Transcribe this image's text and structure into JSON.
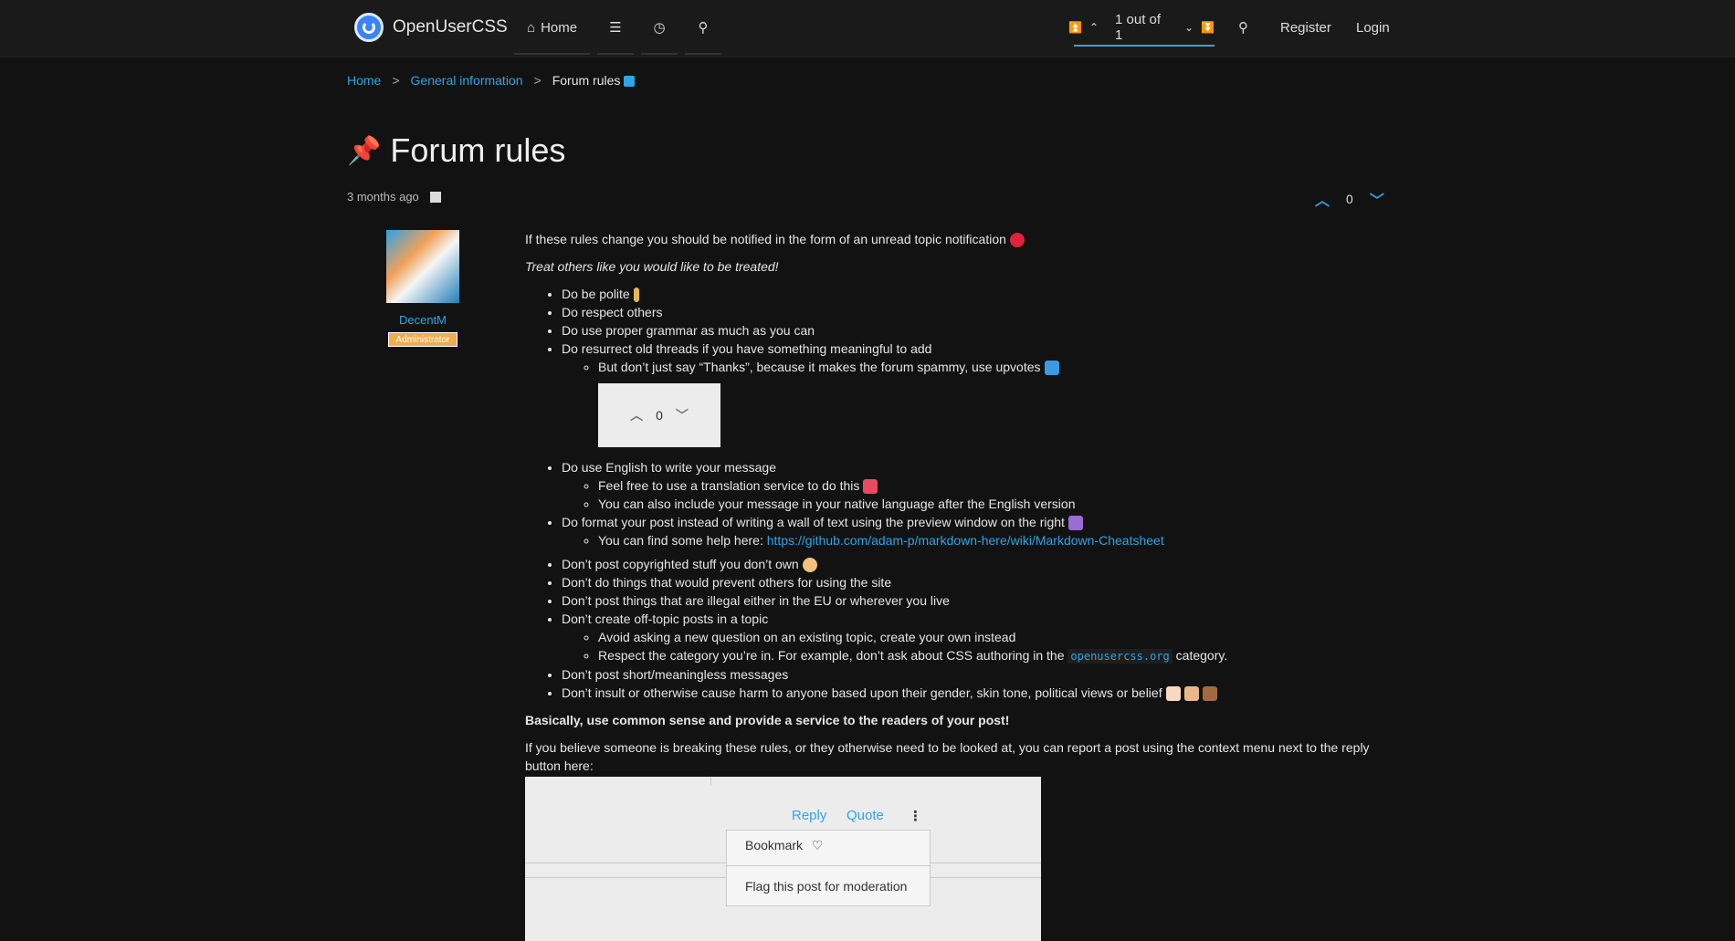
{
  "nav": {
    "brand": "OpenUserCSS",
    "home": "Home",
    "pagination": "1 out of 1",
    "register": "Register",
    "login": "Login"
  },
  "breadcrumb": [
    "Home",
    "General information",
    "Forum rules"
  ],
  "topic": {
    "title": "Forum rules",
    "time": "3 months ago",
    "votes": "0"
  },
  "author": {
    "name": "DecentM",
    "badge": "Administrator"
  },
  "post": {
    "intro": "If these rules change you should be notified in the form of an unread topic notification",
    "treat": "Treat others like you would like to be treated!",
    "rules": [
      "Do be polite",
      "Do respect others",
      "Do use proper grammar as much as you can",
      "Do resurrect old threads if you have something meaningful to add"
    ],
    "sub_thanks": "But don’t just say “Thanks”, because it makes the forum spammy, use upvotes",
    "vote_img_count": "0",
    "english": "Do use English to write your message",
    "sub_translate": "Feel free to use a translation service to do this",
    "sub_native": "You can also include your message in your native language after the English version",
    "format": "Do format your post instead of writing a wall of text using the preview window on the right",
    "sub_help": "You can find some help here:",
    "help_link": "https://github.com/adam-p/markdown-here/wiki/Markdown-Cheatsheet",
    "donts": [
      "Don’t post copyrighted stuff you don’t own",
      "Don’t do things that would prevent others for using the site",
      "Don’t post things that are illegal either in the EU or wherever you live",
      "Don’t create off-topic posts in a topic"
    ],
    "sub_avoid": "Avoid asking a new question on an existing topic, create your own instead",
    "sub_respect_a": "Respect the category you’re in. For example, don’t ask about CSS authoring in the",
    "sub_respect_code": "openusercss.org",
    "sub_respect_b": "category.",
    "short": "Don’t post short/meaningless messages",
    "insult": "Don’t insult or otherwise cause harm to anyone based upon their gender, skin tone, political views or belief",
    "common_sense": "Basically, use common sense and provide a service to the readers of your post!",
    "report": "If you believe someone is breaking these rules, or they otherwise need to be looked at, you can report a post using the context menu next to the reply button here:"
  },
  "screenshot": {
    "reply": "Reply",
    "quote": "Quote",
    "bookmark": "Bookmark",
    "flag": "Flag this post for moderation"
  }
}
